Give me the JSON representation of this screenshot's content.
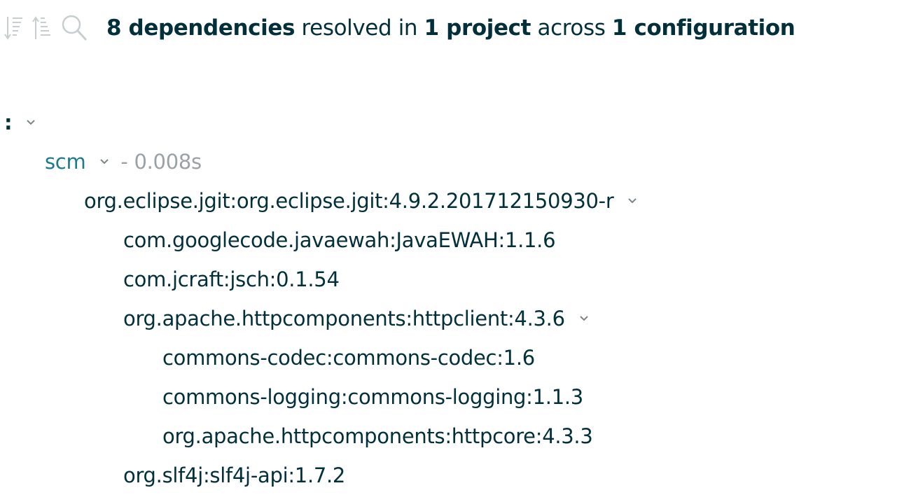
{
  "toolbar": {
    "icons": [
      "sort-descending-icon",
      "sort-ascending-icon",
      "search-icon"
    ],
    "summary": {
      "deps_count": "8 dependencies",
      "resolved_in": " resolved in ",
      "projects_count": "1 project",
      "across": " across ",
      "configs_count": "1 configuration"
    }
  },
  "tree": {
    "root": {
      "label": ":"
    },
    "project": {
      "name": "scm",
      "duration": "- 0.008s"
    },
    "nodes": [
      {
        "label": "org.eclipse.jgit:org.eclipse.jgit:4.9.2.201712150930-r",
        "expandable": true
      },
      {
        "label": "com.googlecode.javaewah:JavaEWAH:1.1.6",
        "expandable": false
      },
      {
        "label": "com.jcraft:jsch:0.1.54",
        "expandable": false
      },
      {
        "label": "org.apache.httpcomponents:httpclient:4.3.6",
        "expandable": true
      },
      {
        "label": "commons-codec:commons-codec:1.6",
        "expandable": false
      },
      {
        "label": "commons-logging:commons-logging:1.1.3",
        "expandable": false
      },
      {
        "label": "org.apache.httpcomponents:httpcore:4.3.3",
        "expandable": false
      },
      {
        "label": "org.slf4j:slf4j-api:1.7.2",
        "expandable": false
      }
    ]
  },
  "colors": {
    "text": "#02303a",
    "project": "#1e7b8c",
    "muted": "#9aa2a6",
    "icon": "#c8cdd0"
  }
}
